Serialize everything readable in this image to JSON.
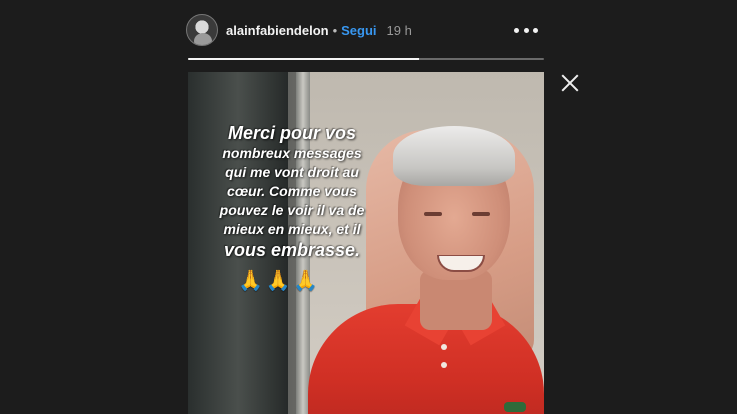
{
  "header": {
    "username": "alainfabiendelon",
    "separator": "•",
    "follow_label": "Segui",
    "timestamp": "19 h"
  },
  "icons": {
    "more": "more-horizontal-icon",
    "close": "close-icon",
    "avatar": "profile-avatar"
  },
  "progress": {
    "fraction": 0.65
  },
  "story": {
    "caption_lines": [
      "Merci pour vos",
      "nombreux messages",
      "qui me vont droit au",
      "cœur. Comme vous",
      "pouvez le voir il va de",
      "mieux en mieux, et il",
      "vous embrasse."
    ],
    "emoji": [
      "🙏",
      "🙏",
      "🙏"
    ]
  },
  "colors": {
    "background": "#1c1c1c",
    "follow": "#3897f0",
    "shirt": "#e33d2f"
  }
}
